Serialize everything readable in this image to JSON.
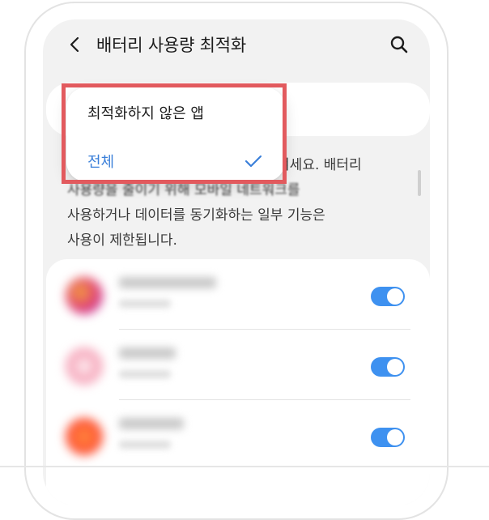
{
  "header": {
    "back_icon": "chevron-left-icon",
    "title": "배터리 사용량 최적화",
    "search_icon": "search-icon"
  },
  "dropdown": {
    "options": [
      {
        "label": "최적화하지 않은 앱",
        "selected": false
      },
      {
        "label": "전체",
        "selected": true
      }
    ],
    "check_icon": "check-icon",
    "selected_color": "#3a7fd9"
  },
  "description": {
    "lines": [
      "를 켜세요. 배터리",
      "사용량을 줄이기 위해 모바일 네트워크를",
      "사용하거나 데이터를 동기화하는 일부 기능은",
      "사용이 제한됩니다."
    ]
  },
  "app_list": {
    "toggle_color": "#3e91f0",
    "apps": [
      {
        "enabled": true,
        "icon_color": "#e0407a"
      },
      {
        "enabled": true,
        "icon_color": "#f39bb3"
      },
      {
        "enabled": true,
        "icon_color": "#ff5a36"
      }
    ]
  },
  "annotation": {
    "highlight_color": "#e25a5e"
  }
}
